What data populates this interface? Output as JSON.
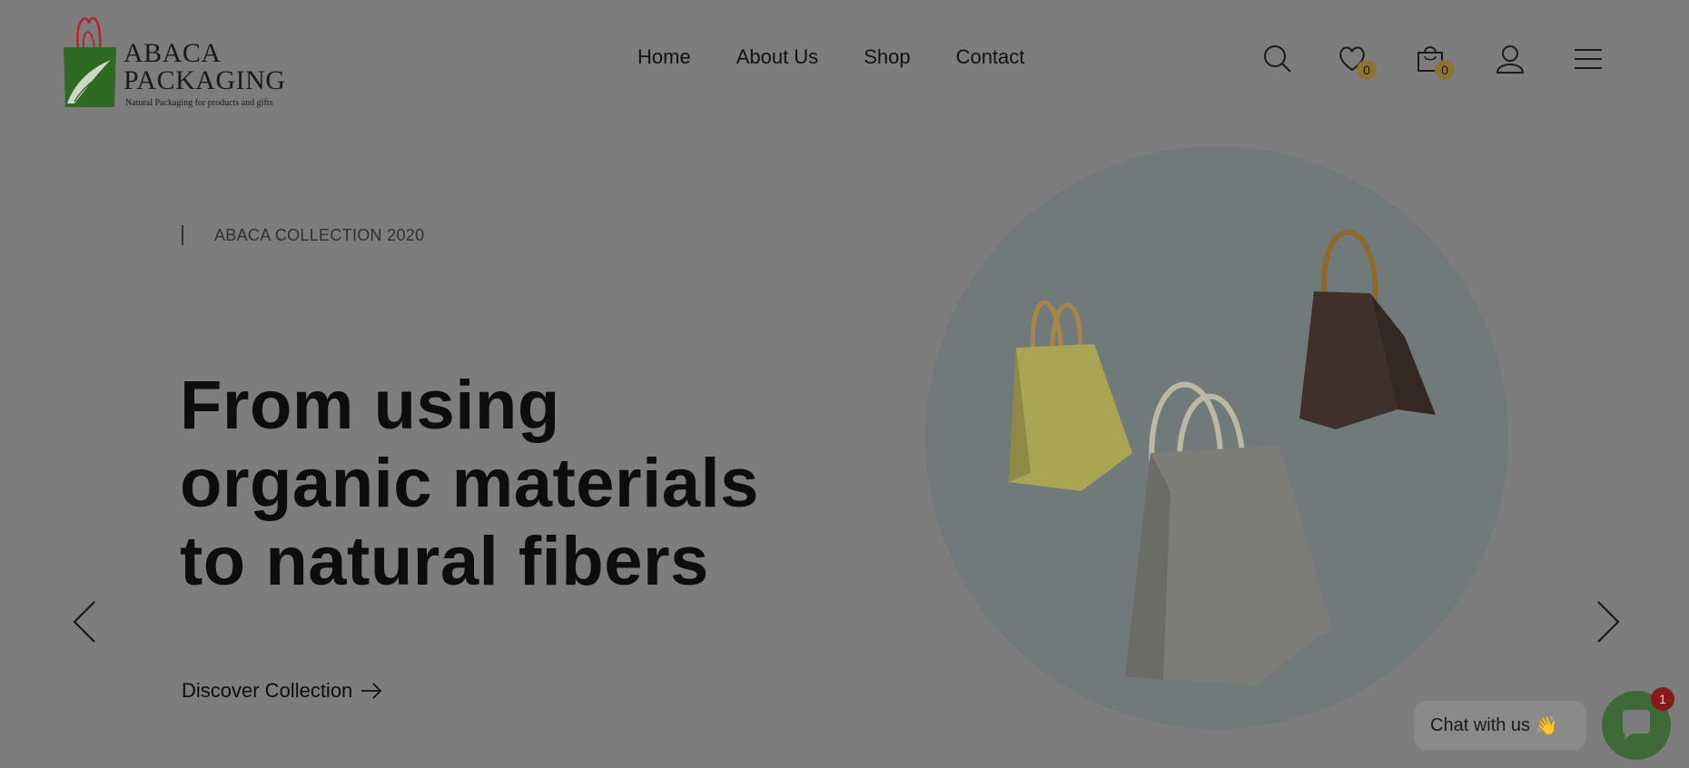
{
  "brand": {
    "name_line1": "ABACA",
    "name_line2": "PACKAGING",
    "tagline": "Natural Packaging for products and gifts",
    "colors": {
      "bag_green": "#2f6a25",
      "handle_red": "#b3262a"
    }
  },
  "nav": {
    "items": [
      "Home",
      "About Us",
      "Shop",
      "Contact"
    ]
  },
  "header_icons": {
    "search": "search-icon",
    "wishlist": "heart-icon",
    "wishlist_count": "0",
    "cart": "shopping-bag-icon",
    "cart_count": "0",
    "account": "user-icon",
    "menu": "hamburger-menu-icon"
  },
  "hero": {
    "eyebrow": "ABACA COLLECTION 2020",
    "headline_lines": [
      "From using",
      "organic materials",
      "to natural fibers"
    ],
    "cta_label": "Discover Collection",
    "cta_icon": "arrow-right-icon",
    "prev_icon": "chevron-left-icon",
    "next_icon": "chevron-right-icon",
    "colors": {
      "circle": "#717a7a",
      "overlay": "#7d7d7d"
    }
  },
  "chat": {
    "label": "Chat with us",
    "emoji": "👋",
    "badge_count": "1",
    "color": "#3d6a37"
  }
}
